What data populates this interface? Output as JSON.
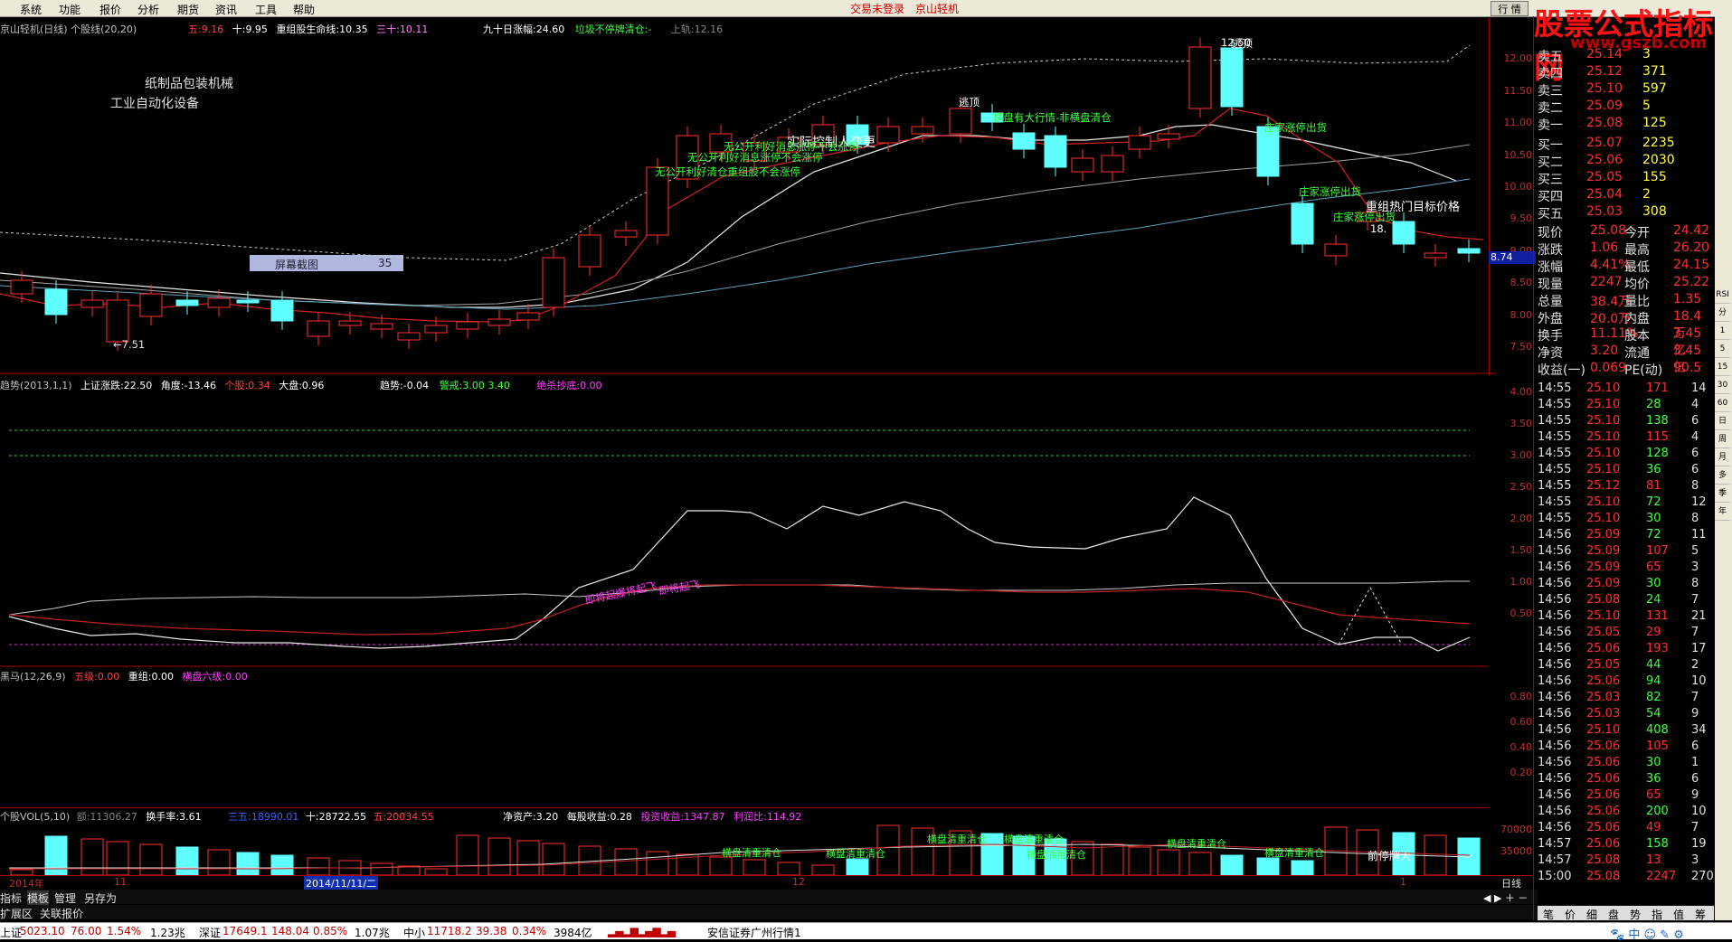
{
  "menu": [
    "系统",
    "功能",
    "报价",
    "分析",
    "期货",
    "资讯",
    "工具",
    "帮助"
  ],
  "title_center": {
    "login": "交易未登录",
    "stock": "京山轻机"
  },
  "window_btn_hq": "行 情",
  "watermark": {
    "title": "股票公式指标网",
    "url": "www.gszb.com"
  },
  "main_chart": {
    "name": "京山轻机(日线)",
    "indicator": "个股线(20,20)",
    "wu_label": "五:",
    "wu_value": "9.16",
    "shi_label": "十:",
    "shi_value": "9.95",
    "chongzu_label": "重组股生命线:",
    "chongzu_value": "10.35",
    "sanshi_label": "三十:",
    "sanshi_value": "10.11",
    "ninety_label": "九十日涨幅:",
    "ninety_value": "24.60",
    "laji_label": "垃圾不停牌清仓:",
    "laji_value": "-",
    "shanggui_label": "上轨:",
    "shanggui_value": "12.16",
    "industry1": "纸制品包装机械",
    "industry2": "工业自动化设备",
    "screenshot_btn": "屏幕截图",
    "screenshot_num": "35",
    "low_label": "←7.51",
    "high_label": "12.50",
    "annotations": {
      "taoding1": "逃顶",
      "taoding2": "逃顶",
      "shiji": "实际控制人变更",
      "hengpan": "横盘有大行情-非横盘清仓",
      "zhuangjia1": "庄家涨停出货",
      "zhuangjia2": "庄家涨停出货",
      "zhuangjia3": "庄家涨停出货",
      "chongzu_target": "重组热门目标价格",
      "target_val": "18.",
      "wugong1": "无公开利好消息涨停不会涨停",
      "wugong2": "无公开利好消息涨停不会涨停",
      "wugong3": "无公开利好清仓重组股不会涨停"
    },
    "current_price_tag": "8.74",
    "axis": [
      "12.00",
      "11.50",
      "11.00",
      "10.50",
      "10.00",
      "9.50",
      "9.00",
      "8.50",
      "8.00",
      "7.50"
    ]
  },
  "trend_panel": {
    "title": "趋势(2013,1,1)",
    "shangzheng_label": "上证涨跌:",
    "shangzheng_value": "22.50",
    "jiaodu_label": "角度:",
    "jiaodu_value": "-13.46",
    "gegu_label": "个股:",
    "gegu_value": "0.34",
    "dapan_label": "大盘:",
    "dapan_value": "0.96",
    "qushi_label": "趋势:",
    "qushi_value": "-0.04",
    "jingjie_label": "警戒:",
    "jingjie_value": "3.00",
    "jingjie_value2": "3.40",
    "jueshao_label": "绝杀抄底:",
    "jueshao_value": "0.00",
    "ann1": "即将起爆将起飞",
    "ann2": "即将起飞",
    "axis": [
      "4.00",
      "3.50",
      "3.00",
      "2.50",
      "2.00",
      "1.50",
      "1.00",
      "0.50"
    ]
  },
  "heima_panel": {
    "title": "黑马(12,26,9)",
    "wuji_label": "五级:",
    "wuji_value": "0.00",
    "chongzu_label": "重组:",
    "chongzu_value": "0.00",
    "hengpan_label": "横盘六级:",
    "hengpan_value": "0.00",
    "axis": [
      "0.80",
      "0.60",
      "0.40",
      "0.20"
    ]
  },
  "vol_panel": {
    "title": "个股VOL(5,10)",
    "e_label": "额:",
    "e_value": "11306.27",
    "huanshou_label": "换手率:",
    "huanshou_value": "3.61",
    "sanwu_label": "三五:",
    "sanwu_value": "18990.01",
    "shi_label": "十:",
    "shi_value": "28722.55",
    "wu_label": "五:",
    "wu_value": "20034.55",
    "jingzichan_label": "净资产:",
    "jingzichan_value": "3.20",
    "meigu_label": "每股收益:",
    "meigu_value": "0.28",
    "touzi_label": "投资收益:",
    "touzi_value": "1347.87",
    "lirun_label": "利润比:",
    "lirun_value": "114.92",
    "anns": [
      "横盘清重清仓",
      "横盘清重清仓",
      "横盘清重清仓",
      "横盘清重清仓",
      "横盘清重清仓",
      "横盘清重清仓",
      "横盘清重清仓",
      "前停牌大"
    ],
    "axis": [
      "70000",
      "35000"
    ]
  },
  "date_axis": {
    "y2014": "2014年",
    "m11": "11",
    "m12": "12",
    "m1": "1",
    "cursor_date": "2014/11/11/二",
    "period": "日线"
  },
  "bottom_tabs": [
    "指标",
    "模板",
    "管理",
    "另存为"
  ],
  "bottom_tabs2": [
    "扩展区",
    "关联报价"
  ],
  "orderbook": {
    "sell": [
      {
        "label": "卖五",
        "price": "25.14",
        "vol": "3"
      },
      {
        "label": "卖四",
        "price": "25.12",
        "vol": "371"
      },
      {
        "label": "卖三",
        "price": "25.10",
        "vol": "597"
      },
      {
        "label": "卖二",
        "price": "25.09",
        "vol": "5"
      },
      {
        "label": "卖一",
        "price": "25.08",
        "vol": "125"
      }
    ],
    "buy": [
      {
        "label": "买一",
        "price": "25.07",
        "vol": "2235"
      },
      {
        "label": "买二",
        "price": "25.06",
        "vol": "2030"
      },
      {
        "label": "买三",
        "price": "25.05",
        "vol": "155"
      },
      {
        "label": "买四",
        "price": "25.04",
        "vol": "2"
      },
      {
        "label": "买五",
        "price": "25.03",
        "vol": "308"
      }
    ]
  },
  "stats": [
    {
      "l1": "现价",
      "v1": "25.08",
      "l2": "今开",
      "v2": "24.42"
    },
    {
      "l1": "涨跌",
      "v1": "1.06",
      "l2": "最高",
      "v2": "26.20"
    },
    {
      "l1": "涨幅",
      "v1": "4.41%",
      "l2": "最低",
      "v2": "24.15"
    },
    {
      "l1": "现量",
      "v1": "2247",
      "l2": "均价",
      "v2": "25.22"
    },
    {
      "l1": "总量",
      "v1": "38.4万",
      "l2": "量比",
      "v2": "1.35"
    },
    {
      "l1": "外盘",
      "v1": "20.0万",
      "l2": "内盘",
      "v2": "18.4万"
    },
    {
      "l1": "换手",
      "v1": "11.11%",
      "l2": "股本",
      "v2": "3.45亿"
    },
    {
      "l1": "净资",
      "v1": "3.20",
      "l2": "流通",
      "v2": "3.45亿"
    },
    {
      "l1": "收益(一)",
      "v1": "0.069",
      "l2": "PE(动)",
      "v2": "90.5"
    }
  ],
  "ticks": [
    {
      "t": "14:55",
      "p": "25.10",
      "v": "171",
      "n": "14"
    },
    {
      "t": "14:55",
      "p": "25.10",
      "v": "28",
      "n": "4"
    },
    {
      "t": "14:55",
      "p": "25.10",
      "v": "138",
      "n": "6"
    },
    {
      "t": "14:55",
      "p": "25.10",
      "v": "115",
      "n": "4"
    },
    {
      "t": "14:55",
      "p": "25.10",
      "v": "128",
      "n": "6"
    },
    {
      "t": "14:55",
      "p": "25.10",
      "v": "36",
      "n": "6"
    },
    {
      "t": "14:55",
      "p": "25.12",
      "v": "81",
      "n": "8"
    },
    {
      "t": "14:55",
      "p": "25.10",
      "v": "72",
      "n": "12"
    },
    {
      "t": "14:55",
      "p": "25.10",
      "v": "30",
      "n": "8"
    },
    {
      "t": "14:56",
      "p": "25.09",
      "v": "72",
      "n": "11"
    },
    {
      "t": "14:56",
      "p": "25.09",
      "v": "107",
      "n": "5"
    },
    {
      "t": "14:56",
      "p": "25.09",
      "v": "65",
      "n": "3"
    },
    {
      "t": "14:56",
      "p": "25.09",
      "v": "30",
      "n": "8"
    },
    {
      "t": "14:56",
      "p": "25.08",
      "v": "24",
      "n": "7"
    },
    {
      "t": "14:56",
      "p": "25.10",
      "v": "131",
      "n": "21"
    },
    {
      "t": "14:56",
      "p": "25.05",
      "v": "29",
      "n": "7"
    },
    {
      "t": "14:56",
      "p": "25.06",
      "v": "193",
      "n": "17"
    },
    {
      "t": "14:56",
      "p": "25.05",
      "v": "44",
      "n": "2"
    },
    {
      "t": "14:56",
      "p": "25.06",
      "v": "94",
      "n": "10"
    },
    {
      "t": "14:56",
      "p": "25.03",
      "v": "82",
      "n": "7"
    },
    {
      "t": "14:56",
      "p": "25.03",
      "v": "54",
      "n": "9"
    },
    {
      "t": "14:56",
      "p": "25.10",
      "v": "408",
      "n": "34"
    },
    {
      "t": "14:56",
      "p": "25.06",
      "v": "105",
      "n": "6"
    },
    {
      "t": "14:56",
      "p": "25.06",
      "v": "30",
      "n": "1"
    },
    {
      "t": "14:56",
      "p": "25.06",
      "v": "36",
      "n": "6"
    },
    {
      "t": "14:56",
      "p": "25.06",
      "v": "65",
      "n": "9"
    },
    {
      "t": "14:56",
      "p": "25.06",
      "v": "200",
      "n": "10"
    },
    {
      "t": "14:56",
      "p": "25.06",
      "v": "49",
      "n": "7"
    },
    {
      "t": "14:57",
      "p": "25.06",
      "v": "158",
      "n": "19"
    },
    {
      "t": "14:57",
      "p": "25.08",
      "v": "13",
      "n": "3"
    },
    {
      "t": "15:00",
      "p": "25.08",
      "v": "2247",
      "n": "270"
    }
  ],
  "side_tabs": [
    "笔",
    "价",
    "细",
    "盘",
    "势",
    "指",
    "值",
    "筹"
  ],
  "status": [
    {
      "name": "上证",
      "val": "5023.10",
      "chg": "76.00",
      "pct": "1.54%",
      "amt": "1.23兆"
    },
    {
      "name": "深证",
      "val": "17649.1",
      "chg": "148.04",
      "pct": "0.85%",
      "amt": "1.07兆"
    },
    {
      "name": "中小",
      "val": "11718.2",
      "chg": "39.38",
      "pct": "0.34%",
      "amt": "3984亿"
    }
  ],
  "broker": "安信证券广州行情1",
  "right_icons": [
    "RSI",
    "分",
    "1",
    "5",
    "15",
    "30",
    "60",
    "日",
    "周",
    "月",
    "多",
    "季",
    "年"
  ]
}
